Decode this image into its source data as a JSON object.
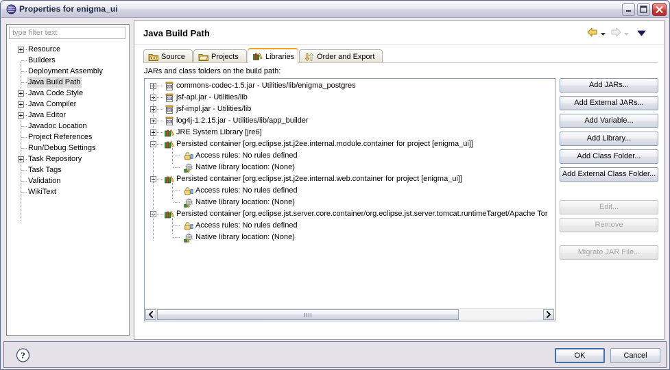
{
  "window": {
    "title": "Properties for enigma_ui",
    "icon": "eclipse-sphere-icon",
    "minimize_label": "Minimize",
    "maximize_label": "Maximize",
    "close_label": "Close"
  },
  "sidebar": {
    "filter": {
      "value": "",
      "placeholder": "type filter text"
    },
    "items": [
      {
        "label": "Resource",
        "expandable": true,
        "selected": false
      },
      {
        "label": "Builders",
        "expandable": false,
        "selected": false
      },
      {
        "label": "Deployment Assembly",
        "expandable": false,
        "selected": false
      },
      {
        "label": "Java Build Path",
        "expandable": false,
        "selected": true
      },
      {
        "label": "Java Code Style",
        "expandable": true,
        "selected": false
      },
      {
        "label": "Java Compiler",
        "expandable": true,
        "selected": false
      },
      {
        "label": "Java Editor",
        "expandable": true,
        "selected": false
      },
      {
        "label": "Javadoc Location",
        "expandable": false,
        "selected": false
      },
      {
        "label": "Project References",
        "expandable": false,
        "selected": false
      },
      {
        "label": "Run/Debug Settings",
        "expandable": false,
        "selected": false
      },
      {
        "label": "Task Repository",
        "expandable": true,
        "selected": false
      },
      {
        "label": "Task Tags",
        "expandable": false,
        "selected": false
      },
      {
        "label": "Validation",
        "expandable": false,
        "selected": false
      },
      {
        "label": "WikiText",
        "expandable": false,
        "selected": false
      }
    ]
  },
  "main": {
    "page_title": "Java Build Path",
    "nav": {
      "back_label": "Back",
      "back_menu_label": "Back history",
      "forward_label": "Forward",
      "forward_menu_label": "Forward history",
      "view_menu_label": "View menu"
    },
    "tabs": [
      {
        "label": "Source",
        "icon": "source-folder-icon",
        "active": false
      },
      {
        "label": "Projects",
        "icon": "project-folder-icon",
        "active": false
      },
      {
        "label": "Libraries",
        "icon": "library-books-icon",
        "active": true
      },
      {
        "label": "Order and Export",
        "icon": "order-arrows-icon",
        "active": false
      }
    ],
    "list_caption": "JARs and class folders on the build path:",
    "tree": [
      {
        "level": 0,
        "expander": "plus",
        "icon": "jar-icon",
        "text": "commons-codec-1.5.jar - Utilities/lib/enigma_postgres"
      },
      {
        "level": 0,
        "expander": "plus",
        "icon": "jar-icon",
        "text": "jsf-api.jar - Utilities/lib"
      },
      {
        "level": 0,
        "expander": "plus",
        "icon": "jar-icon",
        "text": "jsf-impl.jar - Utilities/lib"
      },
      {
        "level": 0,
        "expander": "plus",
        "icon": "jar-icon",
        "text": "log4j-1.2.15.jar - Utilities/lib/app_builder"
      },
      {
        "level": 0,
        "expander": "plus",
        "icon": "library-icon",
        "text": "JRE System Library [jre6]"
      },
      {
        "level": 0,
        "expander": "minus",
        "icon": "library-icon",
        "text": "Persisted container [org.eclipse.jst.j2ee.internal.module.container for project [enigma_ui]]"
      },
      {
        "level": 1,
        "expander": "none",
        "icon": "access-rules-icon",
        "text": "Access rules: No rules defined"
      },
      {
        "level": 1,
        "expander": "none",
        "icon": "native-lib-icon",
        "text": "Native library location: (None)"
      },
      {
        "level": 0,
        "expander": "minus",
        "icon": "library-icon",
        "text": "Persisted container [org.eclipse.jst.j2ee.internal.web.container for project [enigma_ui]]"
      },
      {
        "level": 1,
        "expander": "none",
        "icon": "access-rules-icon",
        "text": "Access rules: No rules defined"
      },
      {
        "level": 1,
        "expander": "none",
        "icon": "native-lib-icon",
        "text": "Native library location: (None)"
      },
      {
        "level": 0,
        "expander": "minus",
        "icon": "library-icon",
        "text": "Persisted container [org.eclipse.jst.server.core.container/org.eclipse.jst.server.tomcat.runtimeTarget/Apache Tor"
      },
      {
        "level": 1,
        "expander": "none",
        "icon": "access-rules-icon",
        "text": "Access rules: No rules defined"
      },
      {
        "level": 1,
        "expander": "none",
        "icon": "native-lib-icon",
        "text": "Native library location: (None)"
      }
    ],
    "scrollbar": {
      "left_arrow_label": "Scroll left",
      "right_arrow_label": "Scroll right"
    },
    "buttons": [
      {
        "label": "Add JARs...",
        "enabled": true
      },
      {
        "label": "Add External JARs...",
        "enabled": true
      },
      {
        "label": "Add Variable...",
        "enabled": true
      },
      {
        "label": "Add Library...",
        "enabled": true
      },
      {
        "label": "Add Class Folder...",
        "enabled": true
      },
      {
        "label": "Add External Class Folder...",
        "enabled": true
      },
      {
        "label": "Edit...",
        "enabled": false
      },
      {
        "label": "Remove",
        "enabled": false
      },
      {
        "label": "Migrate JAR File...",
        "enabled": false
      }
    ]
  },
  "footer": {
    "help_label": "Help",
    "ok_label": "OK",
    "cancel_label": "Cancel"
  },
  "colors": {
    "accent_orange": "#f3a11b",
    "focus_blue": "#3d6fa8",
    "close_red": "#c8352f",
    "selection_gray": "#dcdcdc"
  }
}
